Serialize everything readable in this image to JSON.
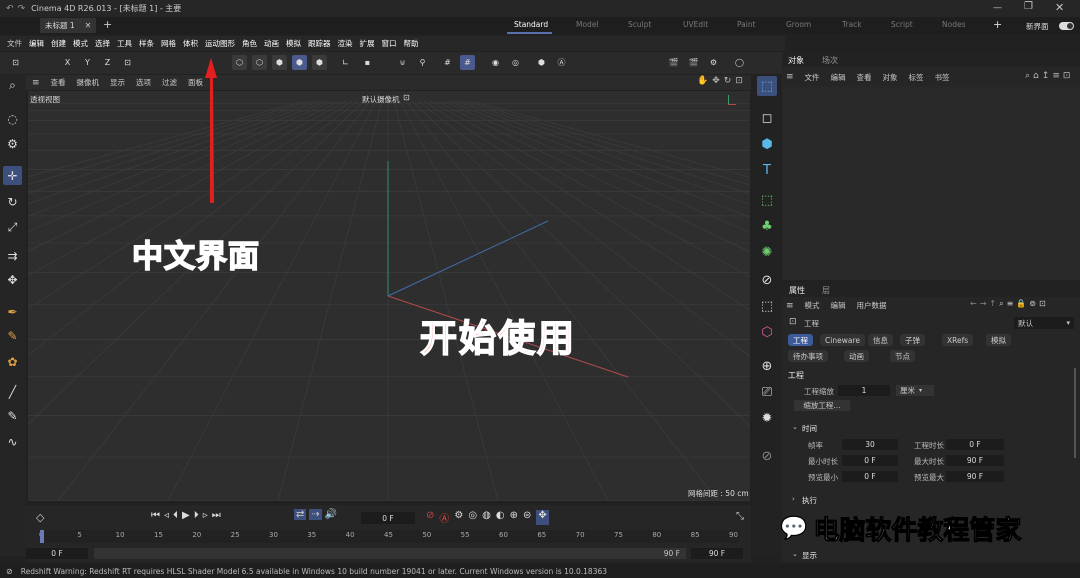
{
  "app": {
    "title": "Cinema 4D R26.013 - [未标题 1] - 主要"
  },
  "doc_tab": {
    "label": "未标题 1"
  },
  "layouts": [
    {
      "label": "Standard",
      "active": true
    },
    {
      "label": "Model"
    },
    {
      "label": "Sculpt"
    },
    {
      "label": "UVEdit"
    },
    {
      "label": "Paint"
    },
    {
      "label": "Groom"
    },
    {
      "label": "Track"
    },
    {
      "label": "Script"
    },
    {
      "label": "Nodes"
    }
  ],
  "new_interface": "新界面",
  "menu": [
    "文件",
    "编辑",
    "创建",
    "模式",
    "选择",
    "工具",
    "样条",
    "网格",
    "体积",
    "运动图形",
    "角色",
    "动画",
    "模拟",
    "跟踪器",
    "渲染",
    "扩展",
    "窗口",
    "帮助"
  ],
  "axis_buttons": [
    "X",
    "Y",
    "Z"
  ],
  "tooltip": {
    "move": "移动"
  },
  "viewport": {
    "menu": [
      "查看",
      "摄像机",
      "显示",
      "选项",
      "过滤",
      "面板"
    ],
    "label": "透视视图",
    "camera": "默认摄像机",
    "grid_info": "网格间距 : 50 cm"
  },
  "overlay": {
    "text1": "中文界面",
    "text2": "开始使用",
    "text1_color": "#ff2a2a",
    "text2_color": "#ff2a2a"
  },
  "objects_panel": {
    "tabs": [
      "对象",
      "场次"
    ],
    "menu": [
      "文件",
      "编辑",
      "查看",
      "对象",
      "标签",
      "书签"
    ]
  },
  "attributes_panel": {
    "tabs": [
      "属性",
      "层"
    ],
    "menu": [
      "模式",
      "编辑",
      "用户数据"
    ],
    "object_label": "工程",
    "preset": "默认",
    "chips_row1": [
      "工程",
      "Cineware",
      "信息",
      "子弹",
      "XRefs",
      "模拟"
    ],
    "chips_row2": [
      "待办事项",
      "动画",
      "节点"
    ],
    "section_title": "工程",
    "scale_label": "工程缩放",
    "scale_value": "1",
    "scale_unit": "厘米",
    "scale_button": "缩放工程...",
    "time_section": "时间",
    "time_rows": [
      {
        "l1": "帧率",
        "v1": "30",
        "l2": "工程时长",
        "v2": "0 F"
      },
      {
        "l1": "最小时长",
        "v1": "0 F",
        "l2": "最大时长",
        "v2": "90 F"
      },
      {
        "l1": "预览最小",
        "v1": "0 F",
        "l2": "预览最大",
        "v2": "90 F"
      }
    ],
    "exec_section": "执行",
    "display_section": "显示"
  },
  "timeline": {
    "current_frame": "0 F",
    "ticks": [
      "0",
      "5",
      "10",
      "15",
      "20",
      "25",
      "30",
      "35",
      "40",
      "45",
      "50",
      "55",
      "60",
      "65",
      "70",
      "75",
      "80",
      "85",
      "90"
    ],
    "range_start": "0 F",
    "range_end": "90 F",
    "end_field": "90 F"
  },
  "status": {
    "text": "Redshift Warning: Redshift RT requires HLSL Shader Model 6.5 available in Windows 10 build number 19041 or later. Current Windows version is 10.0.18363"
  },
  "watermark": {
    "text": "电脑软件教程管家"
  }
}
